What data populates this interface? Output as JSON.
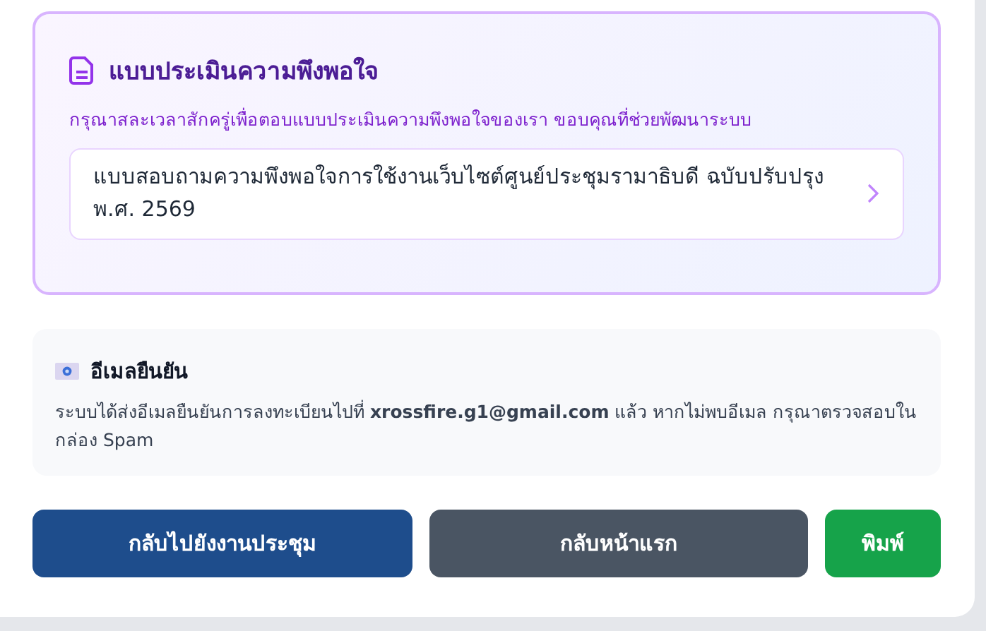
{
  "survey": {
    "title": "แบบประเมินความพึงพอใจ",
    "description": "กรุณาสละเวลาสักครู่เพื่อตอบแบบประเมินความพึงพอใจของเรา ขอบคุณที่ช่วยพัฒนาระบบ",
    "link": {
      "label": "แบบสอบถามความพึงพอใจการใช้งานเว็บไซต์ศูนย์ประชุมรามาธิบดี ฉบับปรับปรุง พ.ศ. 2569"
    }
  },
  "email_notice": {
    "title": "อีเมลยืนยัน",
    "message": "ระบบได้ส่งอีเมลยืนยันการลงทะเบียนไปที่ **xrossfire.g1@gmail.com** แล้ว หากไม่พบอีเมล กรุณาตรวจสอบในกล่อง Spam"
  },
  "buttons": [
    {
      "label": "กลับไปยังงานประชุม",
      "kind": "primary"
    },
    {
      "label": "กลับหน้าแรก",
      "kind": "secondary"
    },
    {
      "label": "พิมพ์",
      "kind": "print"
    }
  ]
}
